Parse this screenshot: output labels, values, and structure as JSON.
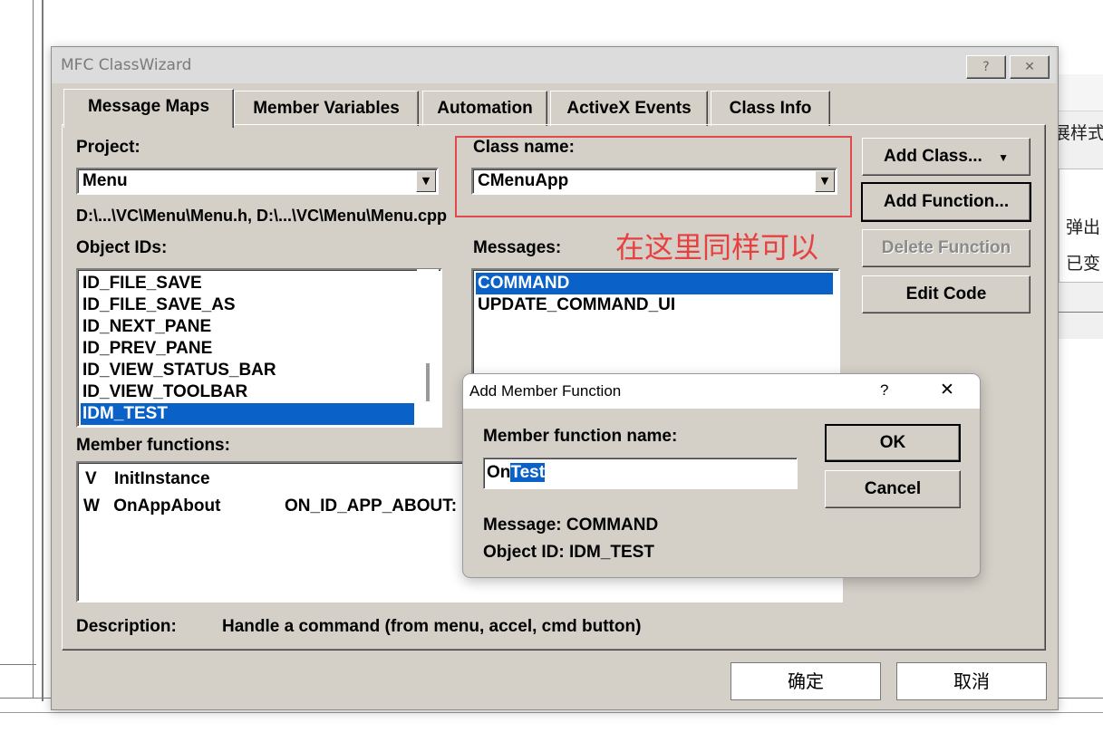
{
  "background": {
    "right_text_1": "展样式",
    "right_text_2": "弹出",
    "right_text_3": "已变"
  },
  "dialog": {
    "title": "MFC ClassWizard",
    "help_glyph": "?",
    "close_glyph": "✕",
    "tabs": [
      "Message Maps",
      "Member Variables",
      "Automation",
      "ActiveX Events",
      "Class Info"
    ],
    "project_label": "Project:",
    "project_value": "Menu",
    "class_label": "Class name:",
    "class_value": "CMenuApp",
    "path_text": "D:\\...\\VC\\Menu\\Menu.h, D:\\...\\VC\\Menu\\Menu.cpp",
    "object_ids_label": "Object IDs:",
    "object_ids": [
      "ID_FILE_SAVE",
      "ID_FILE_SAVE_AS",
      "ID_NEXT_PANE",
      "ID_PREV_PANE",
      "ID_VIEW_STATUS_BAR",
      "ID_VIEW_TOOLBAR",
      "IDM_TEST"
    ],
    "object_ids_selected": "IDM_TEST",
    "messages_label": "Messages:",
    "messages": [
      "COMMAND",
      "UPDATE_COMMAND_UI"
    ],
    "messages_selected": "COMMAND",
    "member_functions_label": "Member functions:",
    "member_functions": [
      {
        "type": "V",
        "name": "InitInstance",
        "handler": ""
      },
      {
        "type": "W",
        "name": "OnAppAbout",
        "handler": "ON_ID_APP_ABOUT:"
      }
    ],
    "description_label": "Description:",
    "description_text": "Handle a command (from menu, accel, cmd button)",
    "buttons": {
      "add_class": "Add Class...",
      "add_class_arrow": "▼",
      "add_function": "Add Function...",
      "delete_function": "Delete Function",
      "edit_code": "Edit Code"
    },
    "annotation": "在这里同样可以",
    "ok_cn": "确定",
    "cancel_cn": "取消"
  },
  "popup": {
    "title": "Add Member Function",
    "help_glyph": "?",
    "close_glyph": "✕",
    "name_label": "Member function name:",
    "name_prefix": "On",
    "name_selected": "Test",
    "ok": "OK",
    "cancel": "Cancel",
    "message_line": "Message: COMMAND",
    "object_line": "Object ID: IDM_TEST"
  }
}
